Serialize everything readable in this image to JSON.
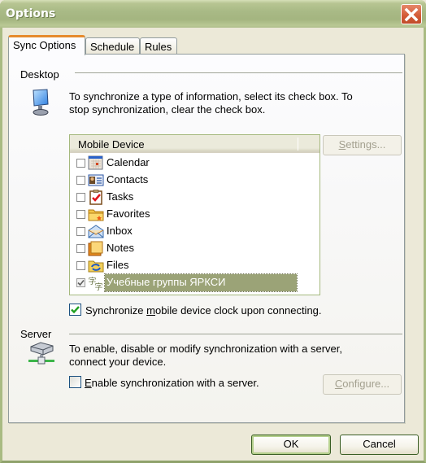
{
  "window": {
    "title": "Options",
    "close_icon": "close-x-icon"
  },
  "tabs": [
    {
      "label": "Sync Options",
      "active": true
    },
    {
      "label": "Schedule",
      "active": false
    },
    {
      "label": "Rules",
      "active": false
    }
  ],
  "desktop": {
    "section_label": "Desktop",
    "icon": "desktop-computer-icon",
    "description_line1": "To synchronize a type of information, select its check box. To",
    "description_line2": "stop synchronization, clear the check box.",
    "list_header": "Mobile Device",
    "items": [
      {
        "label": "Calendar",
        "icon": "calendar-icon",
        "checked": false,
        "selected": false
      },
      {
        "label": "Contacts",
        "icon": "contacts-icon",
        "checked": false,
        "selected": false
      },
      {
        "label": "Tasks",
        "icon": "tasks-icon",
        "checked": false,
        "selected": false
      },
      {
        "label": "Favorites",
        "icon": "favorites-folder-icon",
        "checked": false,
        "selected": false
      },
      {
        "label": "Inbox",
        "icon": "inbox-envelope-icon",
        "checked": false,
        "selected": false
      },
      {
        "label": "Notes",
        "icon": "notes-icon",
        "checked": false,
        "selected": false
      },
      {
        "label": "Files",
        "icon": "files-sync-folder-icon",
        "checked": false,
        "selected": false
      },
      {
        "label": "Учебные группы ЯРКСИ",
        "icon": "kanji-provider-icon",
        "checked": true,
        "selected": true
      }
    ],
    "settings_button": {
      "prefix": "",
      "accel": "S",
      "rest": "ettings...",
      "enabled": false
    },
    "clock_checkbox": {
      "prefix": "Synchronize ",
      "accel": "m",
      "rest": "obile device clock upon connecting.",
      "checked": true
    }
  },
  "server": {
    "section_label": "Server",
    "icon": "server-network-icon",
    "description_line1": "To enable, disable or modify synchronization with a server,",
    "description_line2": "connect your device.",
    "enable_checkbox": {
      "accel": "E",
      "rest": "nable synchronization with a server.",
      "checked": false
    },
    "configure_button": {
      "accel": "C",
      "rest": "onfigure...",
      "enabled": false
    }
  },
  "footer": {
    "ok_label": "OK",
    "cancel_label": "Cancel"
  },
  "colors": {
    "titlebar": "#a9ba86",
    "active_tab_accent": "#e68b2c",
    "selection": "#9ba377",
    "close_button": "#d35a35",
    "check_green": "#21a121"
  }
}
